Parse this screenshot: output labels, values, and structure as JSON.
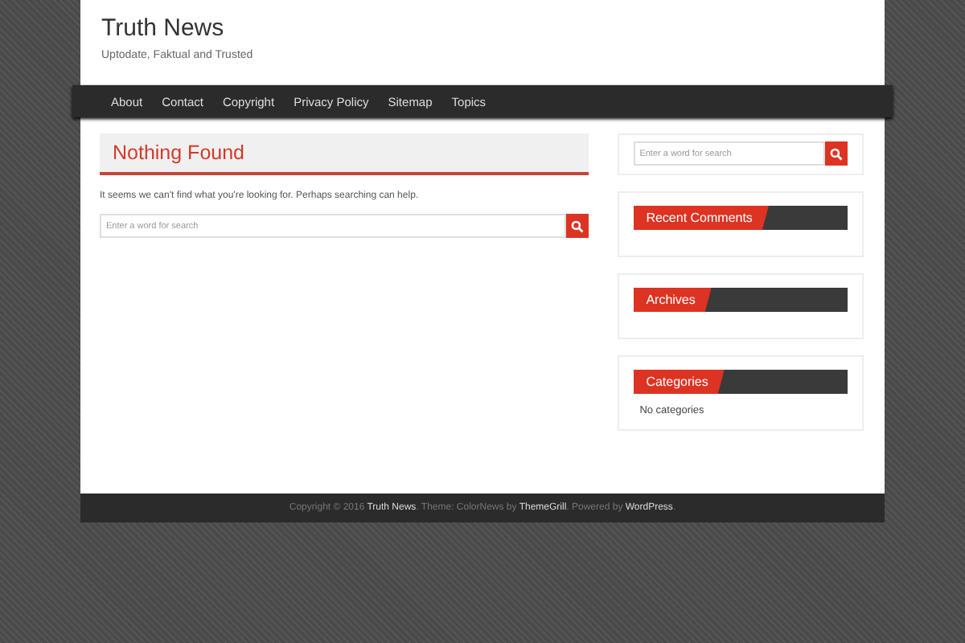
{
  "site": {
    "title": "Truth News",
    "tagline": "Uptodate, Faktual and Trusted"
  },
  "nav": [
    "About",
    "Contact",
    "Copyright",
    "Privacy Policy",
    "Sitemap",
    "Topics"
  ],
  "main": {
    "heading": "Nothing Found",
    "message": "It seems we can't find what you're looking for. Perhaps searching can help.",
    "search": {
      "placeholder": "Enter a word for search"
    }
  },
  "sidebar": [
    {
      "kind": "search",
      "placeholder": "Enter a word for search"
    },
    {
      "kind": "widget",
      "title": "Recent Comments"
    },
    {
      "kind": "widget",
      "title": "Archives"
    },
    {
      "kind": "widget",
      "title": "Categories",
      "body": "No categories"
    }
  ],
  "footer": [
    {
      "text": "Copyright © 2016 ",
      "link": false
    },
    {
      "text": "Truth News",
      "link": true
    },
    {
      "text": ". Theme: ColorNews by ",
      "link": false
    },
    {
      "text": "ThemeGrill",
      "link": true
    },
    {
      "text": ". Powered by ",
      "link": false
    },
    {
      "text": "WordPress",
      "link": true
    },
    {
      "text": ".",
      "link": false
    }
  ]
}
